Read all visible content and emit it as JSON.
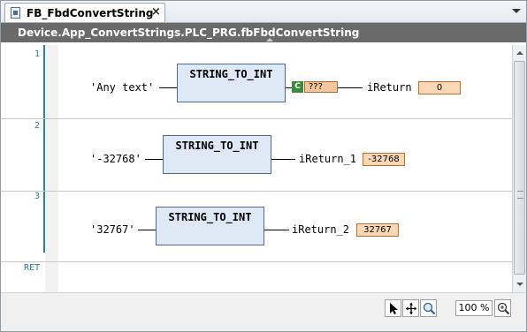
{
  "tab": {
    "title": "FB_FbdConvertString",
    "close": "×"
  },
  "path": "Device.App_ConvertStrings.PLC_PRG.fbFbdConvertString",
  "networks": [
    {
      "number": "1",
      "input": "'Any text'",
      "block": "STRING_TO_INT",
      "badge": "C",
      "block_output": "???",
      "output_var": "iReturn",
      "value": "0"
    },
    {
      "number": "2",
      "input": "'-32768'",
      "block": "STRING_TO_INT",
      "output_var": "iReturn_1",
      "value": "-32768"
    },
    {
      "number": "3",
      "input": "'32767'",
      "block": "STRING_TO_INT",
      "output_var": "iReturn_2",
      "value": "32767"
    },
    {
      "number": "RET"
    }
  ],
  "toolbar": {
    "tools": [
      "pointer-icon",
      "move-icon",
      "zoom-icon"
    ],
    "zoom": "100 %",
    "zoom_tool": "zoom-options-icon"
  },
  "colors": {
    "gutter_line": "#1f8b8b",
    "value_fill": "#fad7b5",
    "block_fill": "#dfe8f5",
    "badge": "#3b8a3b",
    "path_bar": "#6a6a6a"
  }
}
